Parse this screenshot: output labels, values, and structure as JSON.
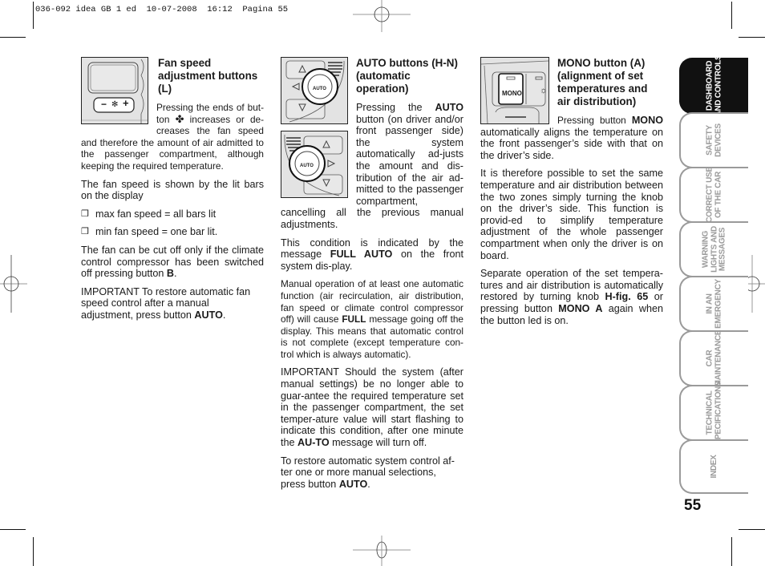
{
  "slug": "036-092 idea GB 1 ed  10-07-2008  16:12  Pagina 55",
  "page_number": "55",
  "column1": {
    "figure": {
      "buttons": {
        "minus": "−",
        "plus": "+"
      }
    },
    "heading": "Fan speed adjustment buttons (L)",
    "p1a": "Pressing the ends of but-ton",
    "p1b": "increases or de-creases the fan speed and therefore the amount of air admitted to the passenger compartment, although keeping the required temperature.",
    "p2": "The fan speed is shown by the lit bars on the display",
    "bullets": [
      "max fan speed = all bars lit",
      "min fan speed = one bar lit."
    ],
    "bullet_glyph": "❒",
    "p3a": "The fan can be cut off only if the climate control compressor has been switched off pressing button ",
    "p3b": "B",
    "p3c": ".",
    "p4a": "IMPORTANT To restore automatic fan speed control after a manual adjustment, press button ",
    "p4b": "AUTO",
    "p4c": "."
  },
  "column2": {
    "figure": {
      "auto_label": "AUTO"
    },
    "heading": "AUTO buttons (H-N) (automatic operation)",
    "p1a": "Pressing the ",
    "p1b": "AUTO",
    "p1c": " button (on driver and/or front passenger side) the system automatically ad-justs the amount and dis-tribution of the air ad-mitted to the passenger compartment, cancelling all the previous manual adjustments.",
    "p2a": "This condition is indicated by the message ",
    "p2b": "FULL AUTO",
    "p2c": " on the front system dis-play.",
    "p3a": "Manual operation of at least one automatic function (air recirculation, air distribution, fan speed or climate control compressor off) will cause ",
    "p3b": "FULL",
    "p3c": " message going off the display. This means that automatic control is not complete (except temperature con-trol which is always automatic).",
    "p4a": "IMPORTANT Should the system (after manual settings) be no longer able to guar-antee the required temperature set in the passenger compartment, the set temper-ature value will start flashing to indicate this condition, after one minute the ",
    "p4b": "AU-TO",
    "p4c": " message will turn off.",
    "p5a": "To restore automatic system control af-ter one or more manual selections, press button ",
    "p5b": "AUTO",
    "p5c": "."
  },
  "column3": {
    "figure": {
      "mono_label": "MONO"
    },
    "heading": "MONO button (A) (alignment of set temperatures and air distribution)",
    "p1a": "Pressing button ",
    "p1b": "MONO",
    "p1c": " automatically aligns the temperature on the front passenger’s side with that on the driver’s side.",
    "p2": "It is therefore possible to set the same temperature and air distribution between the two zones simply turning the knob on the driver’s side. This function is provid-ed to simplify temperature adjustment of the whole passenger compartment when only the driver is on board.",
    "p3a": "Separate operation of the set tempera-tures and air distribution is automatically restored by turning knob ",
    "p3b": "H-fig. 65",
    "p3c": " or pressing button ",
    "p3d": "MONO A",
    "p3e": " again when the button led is on."
  },
  "tabs": [
    {
      "label": "DASHBOARD\nAND CONTROLS",
      "active": true
    },
    {
      "label": "SAFETY\nDEVICES",
      "active": false
    },
    {
      "label": "CORRECT USE\nOF THE CAR",
      "active": false
    },
    {
      "label": "WARNING\nLIGHTS AND\nMESSAGES",
      "active": false
    },
    {
      "label": "IN AN\nEMERGENCY",
      "active": false
    },
    {
      "label": "CAR\nMAINTENANCE",
      "active": false
    },
    {
      "label": "TECHNICAL\nSPECIFICATIONS",
      "active": false
    },
    {
      "label": "INDEX",
      "active": false
    }
  ]
}
